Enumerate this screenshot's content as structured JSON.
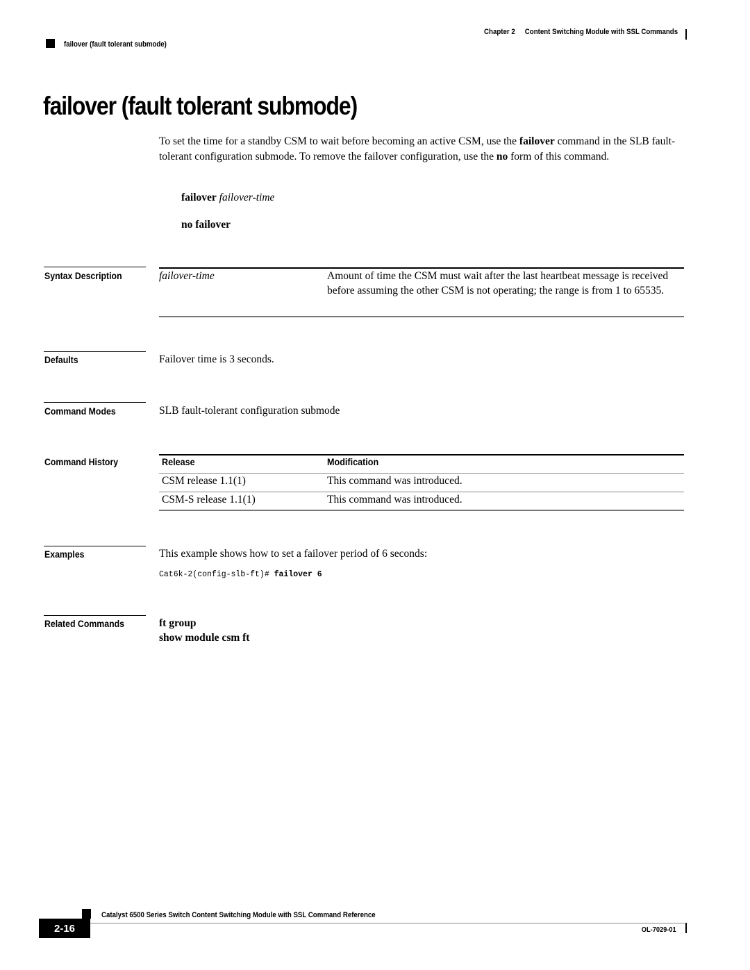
{
  "header": {
    "chapter_label": "Chapter 2",
    "chapter_title": "Content Switching Module with SSL Commands",
    "section_title": "failover (fault tolerant submode)"
  },
  "page_title": "failover (fault tolerant submode)",
  "intro": {
    "part1": "To set the time for a standby CSM to wait before becoming an active CSM, use the ",
    "bold1": "failover",
    "part2": " command in the SLB fault-tolerant configuration submode. To remove the failover configuration, use the ",
    "bold2": "no",
    "part3": " form of this command."
  },
  "syntax": {
    "command_bold": "failover",
    "command_arg": "failover-time",
    "no_form": "no failover"
  },
  "sections": {
    "syntax_description": "Syntax Description",
    "defaults": "Defaults",
    "command_modes": "Command Modes",
    "command_history": "Command History",
    "examples": "Examples",
    "related_commands": "Related Commands"
  },
  "syntax_description": {
    "rows": [
      {
        "argument": "failover-time",
        "description": "Amount of time the CSM must wait after the last heartbeat message is received before assuming the other CSM is not operating; the range is from 1 to 65535."
      }
    ]
  },
  "defaults": "Failover time is 3 seconds.",
  "command_modes": "SLB fault-tolerant configuration submode",
  "command_history": {
    "headers": [
      "Release",
      "Modification"
    ],
    "rows": [
      [
        "CSM release 1.1(1)",
        "This command was introduced."
      ],
      [
        "CSM-S release 1.1(1)",
        "This command was introduced."
      ]
    ]
  },
  "examples": {
    "text": "This example shows how to set a failover period of 6 seconds:",
    "prompt": "Cat6k-2(config-slb-ft)# ",
    "command": "failover 6"
  },
  "related_commands": [
    "ft group",
    "show module csm ft"
  ],
  "footer": {
    "book_title": "Catalyst 6500 Series Switch Content Switching Module with SSL Command Reference",
    "page_number": "2-16",
    "doc_number": "OL-7029-01"
  }
}
